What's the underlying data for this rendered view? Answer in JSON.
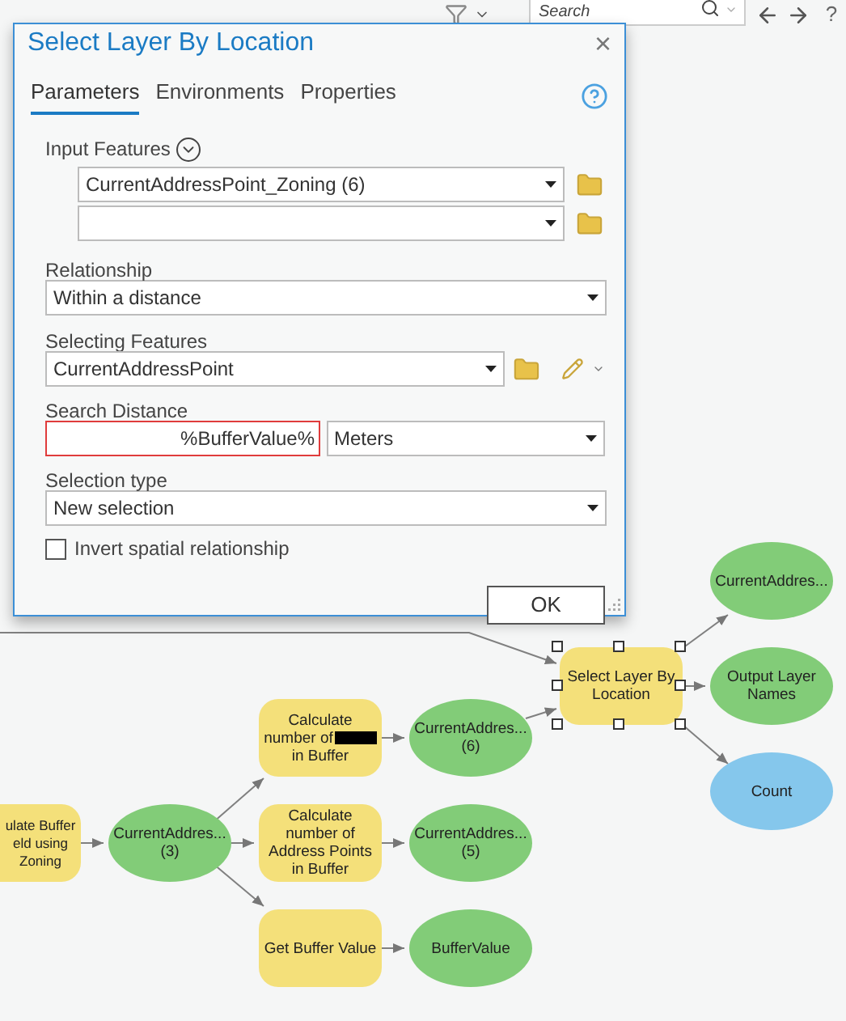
{
  "toolbar": {
    "search": {
      "placeholder": "Search"
    },
    "help": "?"
  },
  "dialog": {
    "title": "Select Layer By Location",
    "close": "×",
    "tabs": [
      {
        "label": "Parameters",
        "selected": true
      },
      {
        "label": "Environments",
        "selected": false
      },
      {
        "label": "Properties",
        "selected": false
      }
    ],
    "input_features": {
      "label": "Input Features",
      "expanded": false,
      "rows": [
        {
          "value": "CurrentAddressPoint_Zoning (6)"
        },
        {
          "value": ""
        }
      ]
    },
    "relationship": {
      "label": "Relationship",
      "value": "Within a distance"
    },
    "selecting_features": {
      "label": "Selecting Features",
      "value": "CurrentAddressPoint"
    },
    "search_distance": {
      "label": "Search Distance",
      "value": "%BufferValue%",
      "error": true,
      "unit": "Meters"
    },
    "selection_type": {
      "label": "Selection type",
      "value": "New selection"
    },
    "invert": {
      "label": "Invert spatial relationship",
      "checked": false
    },
    "ok": "OK"
  },
  "model": {
    "nodes": [
      {
        "kind": "process",
        "lines": [
          "ulate Buffer",
          "eld using",
          "Zoning"
        ],
        "selected": false
      },
      {
        "kind": "data",
        "lines": [
          "CurrentAddres...",
          "(3)"
        ],
        "selected": false
      },
      {
        "kind": "process",
        "lines": [
          "Calculate",
          "number of",
          "in Buffer"
        ],
        "redacted": true,
        "selected": false
      },
      {
        "kind": "process",
        "lines": [
          "Calculate",
          "number of",
          "Address Points",
          "in Buffer"
        ],
        "selected": false
      },
      {
        "kind": "process",
        "lines": [
          "Get Buffer Value"
        ],
        "selected": false
      },
      {
        "kind": "data",
        "lines": [
          "CurrentAddres...",
          "(6)"
        ],
        "selected": false
      },
      {
        "kind": "data",
        "lines": [
          "CurrentAddres...",
          "(5)"
        ],
        "selected": false
      },
      {
        "kind": "data",
        "lines": [
          "BufferValue"
        ],
        "selected": false
      },
      {
        "kind": "process",
        "lines": [
          "Select Layer By",
          "Location"
        ],
        "selected": true
      },
      {
        "kind": "data",
        "lines": [
          "CurrentAddres..."
        ],
        "selected": false
      },
      {
        "kind": "data",
        "lines": [
          "Output Layer",
          "Names"
        ],
        "selected": false
      },
      {
        "kind": "variable",
        "lines": [
          "Count"
        ],
        "selected": false
      }
    ]
  }
}
